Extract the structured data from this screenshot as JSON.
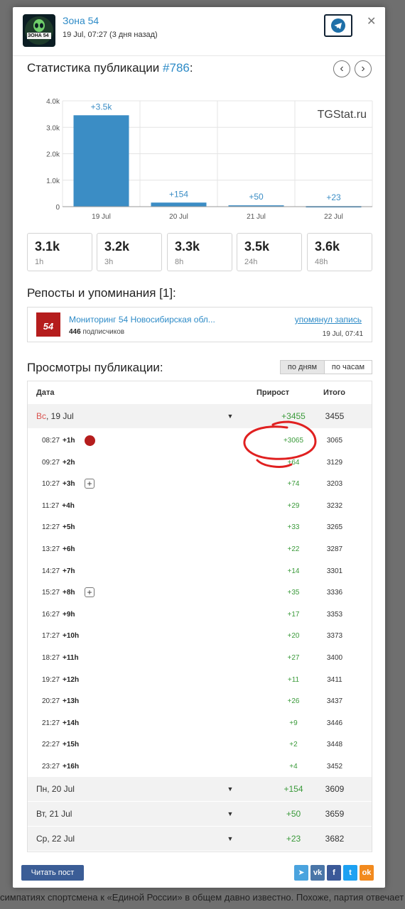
{
  "background": {
    "bottom_text": "симпатиях спортсмена к «Единой России» в общем давно известно. Похоже, партия отвечает ему"
  },
  "header": {
    "channel_name": "Зона 54",
    "post_date": "19 Jul, 07:27 (3 дня назад)",
    "avatar_text": "ЗОНА 54"
  },
  "stats": {
    "title_prefix": "Статистика публикации",
    "post_id": "#786",
    "title_suffix": ":",
    "prev_icon": "chevron-left-icon",
    "next_icon": "chevron-right-icon"
  },
  "chart_data": {
    "type": "bar",
    "categories": [
      "19 Jul",
      "20 Jul",
      "21 Jul",
      "22 Jul"
    ],
    "values": [
      3455,
      154,
      50,
      23
    ],
    "data_labels": [
      "+3.5k",
      "+154",
      "+50",
      "+23"
    ],
    "yticks": [
      "0",
      "1.0k",
      "2.0k",
      "3.0k",
      "4.0k"
    ],
    "ylim": [
      0,
      4000
    ],
    "watermark": "TGStat.ru",
    "bar_color": "#3b8dc5"
  },
  "summary_cards": [
    {
      "value": "3.1k",
      "label": "1h"
    },
    {
      "value": "3.2k",
      "label": "3h"
    },
    {
      "value": "3.3k",
      "label": "8h"
    },
    {
      "value": "3.5k",
      "label": "24h"
    },
    {
      "value": "3.6k",
      "label": "48h"
    }
  ],
  "reposts": {
    "title": "Репосты и упоминания [1]:",
    "item": {
      "name": "Мониторинг 54 Новосибирская обл...",
      "subs_count": "446",
      "subs_label": "подписчиков",
      "logo_text": "54",
      "action": "упомянул запись",
      "date": "19 Jul, 07:41"
    }
  },
  "views": {
    "title": "Просмотры публикации:",
    "toggle_days": "по дням",
    "toggle_hours": "по часам",
    "col_date": "Дата",
    "col_growth": "Прирост",
    "col_total": "Итого",
    "day1": {
      "weekday": "Вс",
      "date": ", 19 Jul",
      "growth": "+3455",
      "total": "3455"
    },
    "hours": [
      {
        "time": "08:27",
        "h": "+1h",
        "growth": "+3065",
        "total": "3065"
      },
      {
        "time": "09:27",
        "h": "+2h",
        "growth": "+64",
        "total": "3129"
      },
      {
        "time": "10:27",
        "h": "+3h",
        "growth": "+74",
        "total": "3203"
      },
      {
        "time": "11:27",
        "h": "+4h",
        "growth": "+29",
        "total": "3232"
      },
      {
        "time": "12:27",
        "h": "+5h",
        "growth": "+33",
        "total": "3265"
      },
      {
        "time": "13:27",
        "h": "+6h",
        "growth": "+22",
        "total": "3287"
      },
      {
        "time": "14:27",
        "h": "+7h",
        "growth": "+14",
        "total": "3301"
      },
      {
        "time": "15:27",
        "h": "+8h",
        "growth": "+35",
        "total": "3336"
      },
      {
        "time": "16:27",
        "h": "+9h",
        "growth": "+17",
        "total": "3353"
      },
      {
        "time": "17:27",
        "h": "+10h",
        "growth": "+20",
        "total": "3373"
      },
      {
        "time": "18:27",
        "h": "+11h",
        "growth": "+27",
        "total": "3400"
      },
      {
        "time": "19:27",
        "h": "+12h",
        "growth": "+11",
        "total": "3411"
      },
      {
        "time": "20:27",
        "h": "+13h",
        "growth": "+26",
        "total": "3437"
      },
      {
        "time": "21:27",
        "h": "+14h",
        "growth": "+9",
        "total": "3446"
      },
      {
        "time": "22:27",
        "h": "+15h",
        "growth": "+2",
        "total": "3448"
      },
      {
        "time": "23:27",
        "h": "+16h",
        "growth": "+4",
        "total": "3452"
      }
    ],
    "other_days": [
      {
        "label": "Пн, 20 Jul",
        "growth": "+154",
        "total": "3609"
      },
      {
        "label": "Вт, 21 Jul",
        "growth": "+50",
        "total": "3659"
      },
      {
        "label": "Ср, 22 Jul",
        "growth": "+23",
        "total": "3682"
      }
    ]
  },
  "footer": {
    "read_post": "Читать пост",
    "share_icons": [
      "telegram-icon",
      "vk-icon",
      "facebook-icon",
      "twitter-icon",
      "odnoklassniki-icon"
    ],
    "share_glyphs": [
      "➤",
      "vk",
      "f",
      "t",
      "ok"
    ],
    "share_colors": [
      "#4aa3de",
      "#4a76a8",
      "#3b5998",
      "#1da1f2",
      "#f28a1e"
    ]
  },
  "annotation_color": "#e02020"
}
